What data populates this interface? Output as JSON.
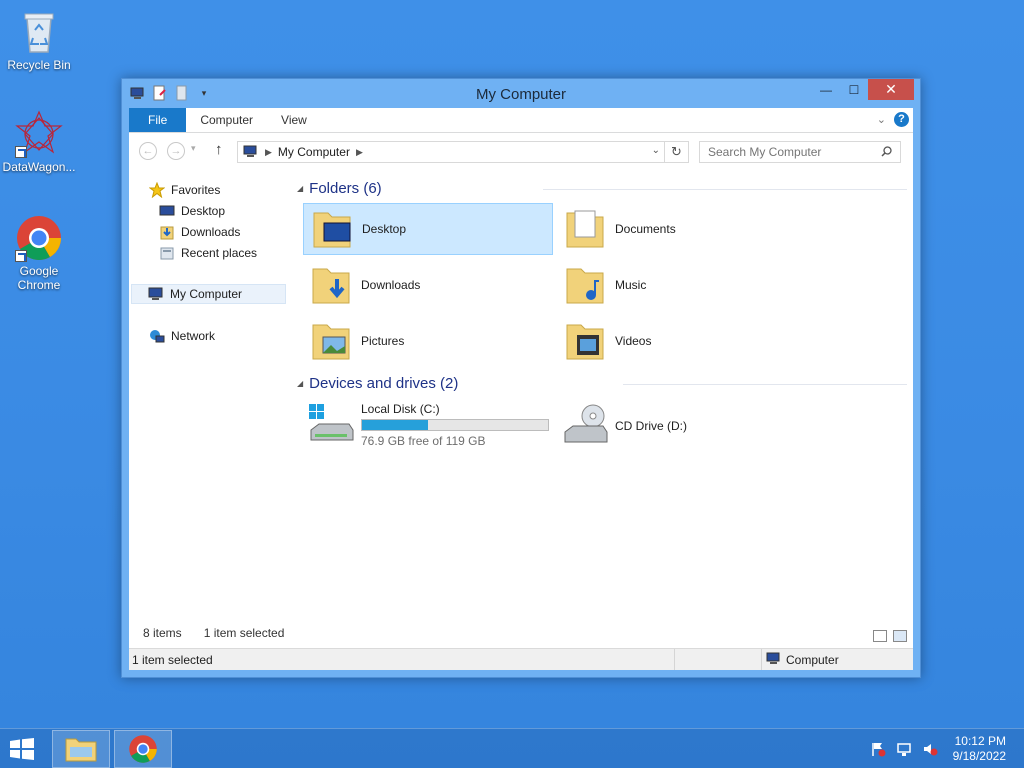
{
  "desktop": {
    "icons": [
      {
        "label": "Recycle Bin",
        "icon": "recycle-bin-icon"
      },
      {
        "label": "DataWagon...",
        "icon": "datawagon-icon"
      },
      {
        "label": "Google Chrome",
        "icon": "chrome-icon"
      }
    ]
  },
  "window": {
    "title": "My Computer",
    "controls": {
      "minimize": "—",
      "maximize": "☐",
      "close": "✕"
    },
    "ribbon_tabs": [
      "File",
      "Computer",
      "View"
    ],
    "help": "?",
    "address": {
      "location": "My Computer"
    },
    "search": {
      "placeholder": "Search My Computer"
    },
    "nav_pane": {
      "favorites": "Favorites",
      "favorites_items": [
        "Desktop",
        "Downloads",
        "Recent places"
      ],
      "this_pc": "My Computer",
      "network": "Network"
    },
    "folders_group": "Folders (6)",
    "folders": [
      "Desktop",
      "Documents",
      "Downloads",
      "Music",
      "Pictures",
      "Videos"
    ],
    "drives_group": "Devices and drives (2)",
    "drives": [
      {
        "name": "Local Disk (C:)",
        "free": "76.9 GB free of 119 GB",
        "used_fraction": 0.354
      },
      {
        "name": "CD Drive (D:)"
      }
    ],
    "status": {
      "items": "8 items",
      "selected": "1 item selected"
    },
    "statusbar": {
      "left": "1 item selected",
      "right": "Computer"
    }
  },
  "taskbar": {
    "clock_time": "10:12 PM",
    "clock_date": "9/18/2022"
  },
  "colors": {
    "accent": "#1979ca",
    "selection": "#cce8ff",
    "close": "#c7504b",
    "drive_bar": "#26a0da"
  }
}
